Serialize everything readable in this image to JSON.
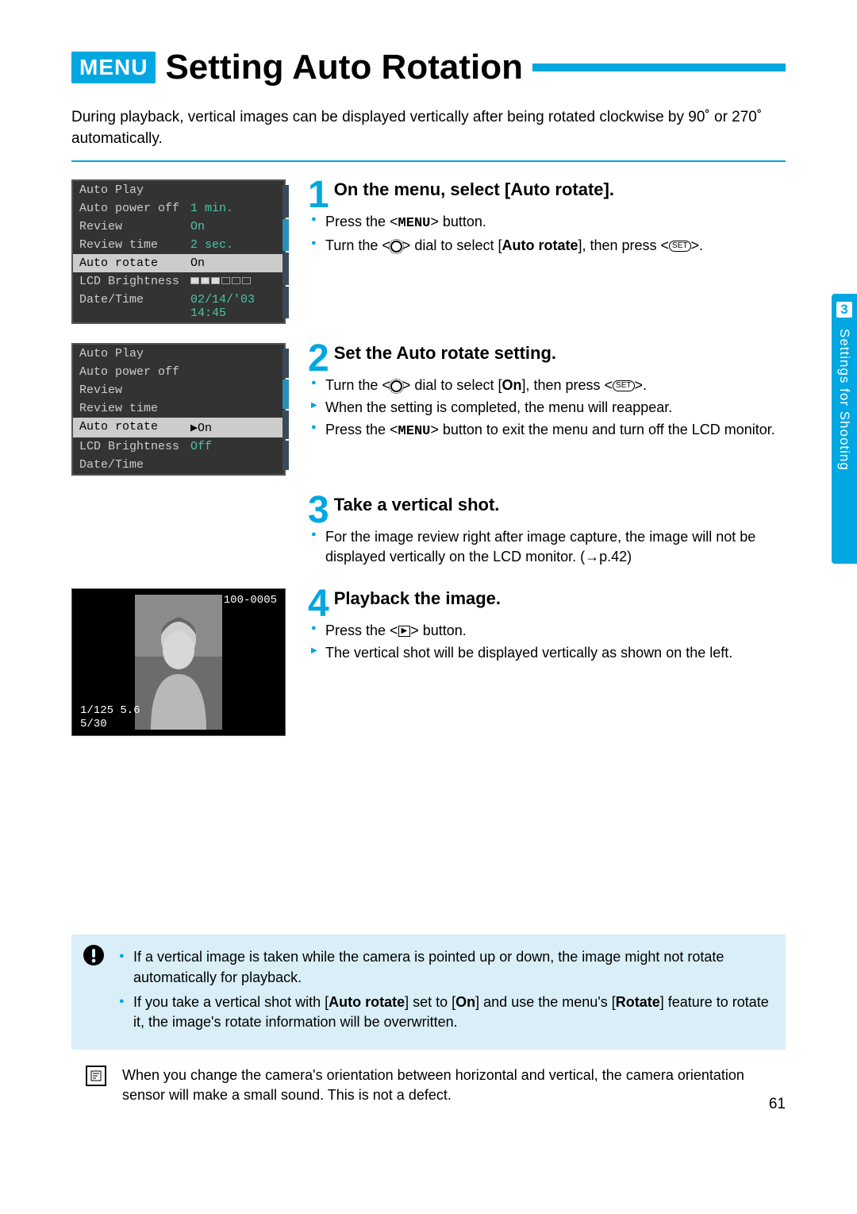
{
  "header": {
    "badge": "MENU",
    "title": "Setting Auto Rotation"
  },
  "intro": "During playback, vertical images can be displayed vertically after being rotated clockwise by 90˚ or 270˚ automatically.",
  "menu_shot1": {
    "rows": [
      {
        "label": "Auto Play",
        "val": ""
      },
      {
        "label": "Auto power off",
        "val": "1 min."
      },
      {
        "label": "Review",
        "val": "On"
      },
      {
        "label": "Review time",
        "val": "2 sec."
      },
      {
        "label": "Auto rotate",
        "val": "On",
        "hi": true
      },
      {
        "label": "LCD Brightness",
        "val": "",
        "bar": true
      },
      {
        "label": "Date/Time",
        "val": "02/14/'03 14:45"
      }
    ]
  },
  "menu_shot2": {
    "rows": [
      {
        "label": "Auto Play",
        "val": ""
      },
      {
        "label": "Auto power off",
        "val": ""
      },
      {
        "label": "Review",
        "val": ""
      },
      {
        "label": "Review time",
        "val": ""
      },
      {
        "label": "Auto rotate",
        "val": "▶On",
        "hi": true
      },
      {
        "label": "LCD Brightness",
        "val": "Off"
      },
      {
        "label": "Date/Time",
        "val": ""
      }
    ]
  },
  "steps": [
    {
      "num": "1",
      "title": "On the menu, select [Auto rotate].",
      "bullets": [
        {
          "html": "Press the <<b class=\"mono\">MENU</b>> button."
        },
        {
          "html": "Turn the <<span class=\"icon-dial\"></span>> dial to select [<b>Auto rotate</b>], then press <<span class=\"icon-set\">SET</span>>."
        }
      ]
    },
    {
      "num": "2",
      "title": "Set the Auto rotate setting.",
      "bullets": [
        {
          "html": "Turn the <<span class=\"icon-dial\"></span>> dial to select [<b>On</b>], then press <<span class=\"icon-set\">SET</span>>."
        },
        {
          "arrow": true,
          "html": "When the setting is completed, the menu will reappear."
        },
        {
          "html": "Press the <<b class=\"mono\">MENU</b>> button to exit the menu and turn off the LCD monitor."
        }
      ]
    },
    {
      "num": "3",
      "title": "Take a vertical shot.",
      "bullets": [
        {
          "html": "For the image review right after image capture, the image will not be displayed vertically on the LCD monitor. (→p.42)"
        }
      ]
    },
    {
      "num": "4",
      "title": "Playback the image.",
      "bullets": [
        {
          "html": "Press the <<span class=\"icon-play\">▶</span>> button."
        },
        {
          "arrow": true,
          "html": "The vertical shot will be displayed vertically as shown on the left."
        }
      ]
    }
  ],
  "playback": {
    "file": "100-0005",
    "exposure": "1/125  5.6",
    "count": "5/30"
  },
  "side_tab": {
    "chapter": "3",
    "label": "Settings for Shooting"
  },
  "warning_notes": [
    "If a vertical image is taken while the camera is pointed up or down, the image might not rotate automatically for playback.",
    "If you take a vertical shot with [<b>Auto rotate</b>] set to [<b>On</b>] and use the menu's [<b>Rotate</b>] feature to rotate it, the image's rotate information will be overwritten."
  ],
  "info_note": "When you change the camera's orientation between horizontal and vertical, the camera orientation sensor will make a small sound. This is not a defect.",
  "page_number": "61"
}
